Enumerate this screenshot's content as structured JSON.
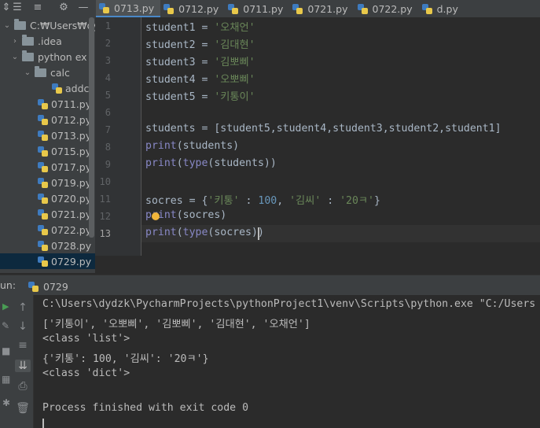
{
  "tabs": [
    {
      "label": "0713.py",
      "active": true
    },
    {
      "label": "0712.py",
      "active": false
    },
    {
      "label": "0711.py",
      "active": false
    },
    {
      "label": "0721.py",
      "active": false
    },
    {
      "label": "0722.py",
      "active": false
    },
    {
      "label": "d.py",
      "active": false
    }
  ],
  "tree": {
    "root": "C:₩Users₩dydzk",
    "idea": ".idea",
    "python_ex": "python ex",
    "calc": "calc",
    "addcal": "addcal.py",
    "files": [
      "0711.py",
      "0712.py",
      "0713.py",
      "0715.py",
      "0717.py",
      "0719.py",
      "0720.py",
      "0721.py",
      "0722.py",
      "0728.py",
      "0729.py"
    ],
    "selected": "0729.py"
  },
  "editor": {
    "line_numbers": [
      "1",
      "2",
      "3",
      "4",
      "5",
      "6",
      "7",
      "8",
      "9",
      "10",
      "11",
      "12",
      "13"
    ],
    "current_line": "13",
    "l1": {
      "v": "student1 = ",
      "s": "'오채언'"
    },
    "l2": {
      "v": "student2 = ",
      "s": "'김대현'"
    },
    "l3": {
      "v": "student3 = ",
      "s": "'김뽀삐'"
    },
    "l4": {
      "v": "student4 = ",
      "s": "'오뽀삐'"
    },
    "l5": {
      "v": "student5 = ",
      "s": "'키통이'"
    },
    "l7": "students = [student5,student4,student3,student2,student1]",
    "l8": {
      "fn": "print",
      "rest": "(students)"
    },
    "l9": {
      "fn": "print",
      "a": "(",
      "fn2": "type",
      "rest": "(students))"
    },
    "l11": {
      "a": "socres = {",
      "k1": "'키통'",
      "b": " : ",
      "n1": "100",
      "c": ", ",
      "k2": "'김씨'",
      "d": " : ",
      "s2": "'20ㅋ'",
      "e": "}"
    },
    "l12": {
      "fn": "print",
      "rest": "(socres)"
    },
    "l13": {
      "fn": "print",
      "a": "(",
      "fn2": "type",
      "rest": "(socres))"
    }
  },
  "run": {
    "label": "un:",
    "config": "0729",
    "output": [
      "C:\\Users\\dydzk\\PycharmProjects\\pythonProject1\\venv\\Scripts\\python.exe \"C:/Users",
      "['키통이', '오뽀삐', '김뽀삐', '김대현', '오채언']",
      "<class 'list'>",
      "{'키통': 100, '김씨': '20ㅋ'}",
      "<class 'dict'>",
      "",
      "Process finished with exit code 0"
    ]
  },
  "colors": {
    "string": "#6a8759",
    "number": "#6897bb",
    "builtin": "#8888c6",
    "text": "#a9b7c6",
    "accent": "#4a88c7"
  }
}
